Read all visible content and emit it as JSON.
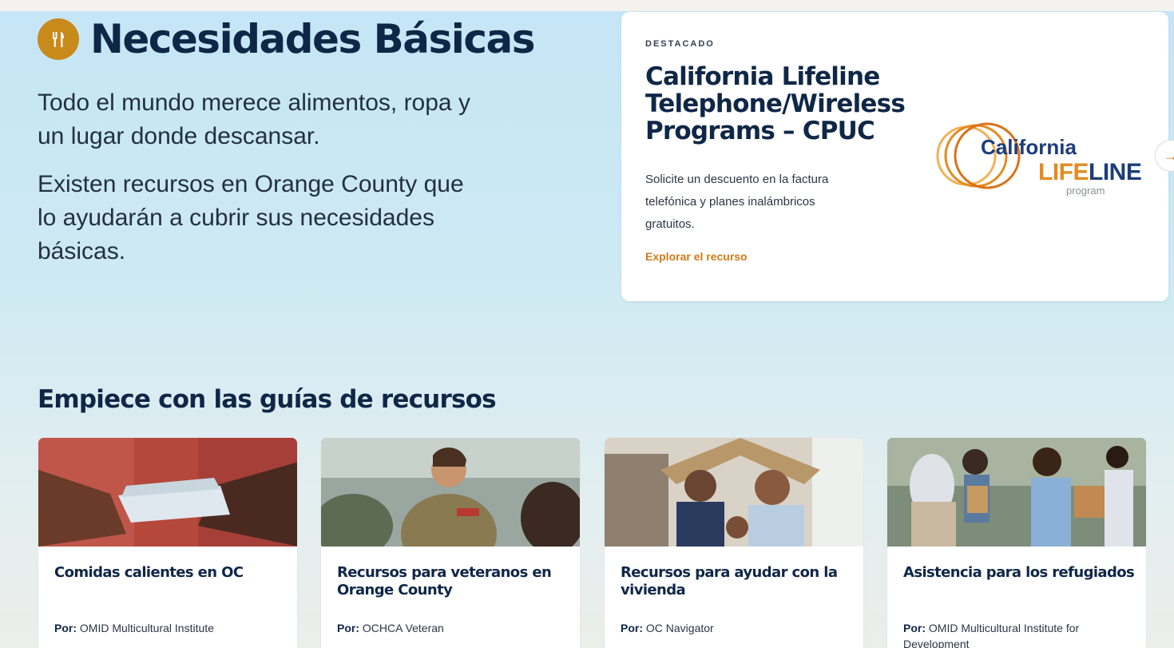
{
  "hero": {
    "title": "Necesidades Básicas",
    "title_icon": "utensils-icon",
    "intro_1": "Todo el mundo merece alimentos, ropa y un lugar donde descansar.",
    "intro_2": "Existen recursos en Orange County que lo ayudarán a cubrir sus necesidades básicas."
  },
  "featured": {
    "kicker": "DESTACADO",
    "title": "California Lifeline Telephone/Wireless Programs – CPUC",
    "description": "Solicite un descuento en la factura telefónica y planes inalámbricos gratuitos.",
    "link_label": "Explorar el recurso",
    "logo": {
      "line1": "California",
      "life": "LIFE",
      "line": "LINE",
      "program": "program"
    },
    "next_icon": "arrow-right-icon"
  },
  "guides": {
    "section_title": "Empiece con las guías de recursos",
    "by_label": "Por:",
    "items": [
      {
        "title": "Comidas calientes en OC",
        "author": "OMID Multicultural Institute",
        "image": "food-handoff-photo"
      },
      {
        "title": "Recursos para veteranos en Orange County",
        "author": "OCHCA Veteran",
        "image": "veterans-photo"
      },
      {
        "title": "Recursos para ayudar con la vivienda",
        "author": "OC Navigator",
        "image": "family-housing-photo"
      },
      {
        "title": "Asistencia para los refugiados",
        "author": "OMID Multicultural Institute for Development",
        "image": "refugee-assistance-photo"
      }
    ]
  },
  "colors": {
    "navy": "#0f2747",
    "accent_orange": "#d07a16",
    "icon_gold": "#c98a1c"
  }
}
